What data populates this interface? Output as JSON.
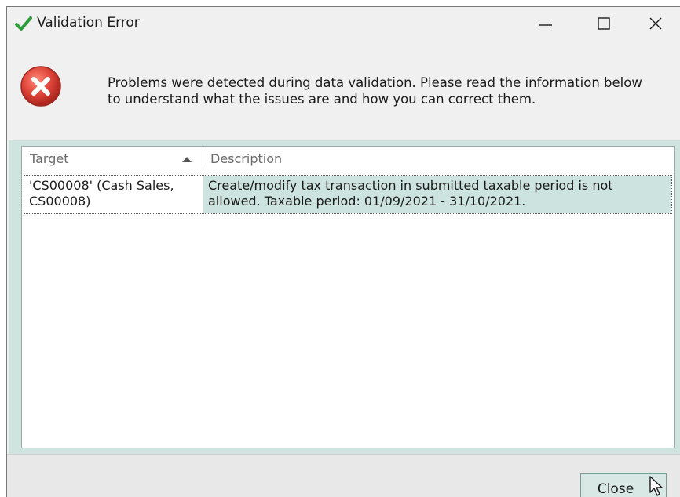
{
  "window": {
    "title": "Validation Error",
    "title_icon": "checkmark-icon",
    "controls": {
      "minimize": "minimize-icon",
      "maximize": "maximize-icon",
      "close": "close-icon"
    }
  },
  "header": {
    "icon": "error-icon",
    "message": "Problems were detected during data validation. Please read the information below\nto understand what the issues are and how you can correct them."
  },
  "grid": {
    "columns": [
      {
        "label": "Target",
        "sort": "ascending"
      },
      {
        "label": "Description"
      }
    ],
    "rows": [
      {
        "target": "'CS00008' (Cash Sales,\nCS00008)",
        "description": "Create/modify tax transaction in submitted taxable period is not\nallowed. Taxable period: 01/09/2021 - 31/10/2021."
      }
    ]
  },
  "footer": {
    "close_label": "Close"
  },
  "colors": {
    "accent": "#cde3df",
    "error_red": "#e0453a",
    "check_green": "#2e9e3c"
  }
}
